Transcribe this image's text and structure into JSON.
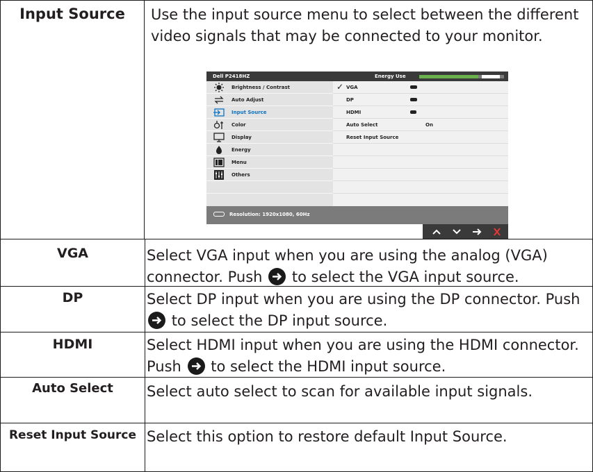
{
  "rows": [
    {
      "name": "Input Source",
      "description": "Use the input source menu to select between the different video signals that may be connected to your monitor."
    },
    {
      "name": "VGA",
      "description_before": "Select VGA input when you are using the analog (VGA) connector. Push",
      "description_after": "to select the VGA input source."
    },
    {
      "name": "DP",
      "description_before": "Select DP input when you are using the DP connector. Push",
      "description_after": "to select the DP input source."
    },
    {
      "name": "HDMI",
      "description_before": "Select HDMI input when you are using the HDMI connector. Push",
      "description_after": "to select the HDMI input source."
    },
    {
      "name": "Auto Select",
      "description": "Select auto select to scan for available input signals."
    },
    {
      "name": "Reset Input Source",
      "description": "Select this option to restore default Input Source."
    }
  ],
  "osd": {
    "model": "Dell P2418HZ",
    "energy_label": "Energy Use",
    "energy_level": 0.7,
    "menu_items": [
      {
        "label": "Brightness / Contrast",
        "icon": "brightness-icon"
      },
      {
        "label": "Auto Adjust",
        "icon": "auto-adjust-icon"
      },
      {
        "label": "Input Source",
        "icon": "input-source-icon"
      },
      {
        "label": "Color",
        "icon": "color-icon"
      },
      {
        "label": "Display",
        "icon": "display-icon"
      },
      {
        "label": "Energy",
        "icon": "energy-icon"
      },
      {
        "label": "Menu",
        "icon": "menu-icon"
      },
      {
        "label": "Others",
        "icon": "others-icon"
      }
    ],
    "active_item": "Input Source",
    "options": [
      {
        "label": "VGA",
        "checked": true,
        "icon": "vga-port-icon",
        "value": ""
      },
      {
        "label": "DP",
        "checked": false,
        "icon": "dp-port-icon",
        "value": ""
      },
      {
        "label": "HDMI",
        "checked": false,
        "icon": "hdmi-port-icon",
        "value": ""
      },
      {
        "label": "Auto Select",
        "checked": false,
        "icon": "",
        "value": "On"
      },
      {
        "label": "Reset Input Source",
        "checked": false,
        "icon": "",
        "value": ""
      }
    ],
    "resolution": "Resolution: 1920x1080, 60Hz",
    "check_mark": "✓",
    "keys": [
      "up-arrow-icon",
      "down-arrow-icon",
      "right-arrow-icon",
      "close-icon"
    ],
    "colors": {
      "active": "#0b72c2",
      "energy": "#6ab04c",
      "close": "#e53935"
    }
  }
}
